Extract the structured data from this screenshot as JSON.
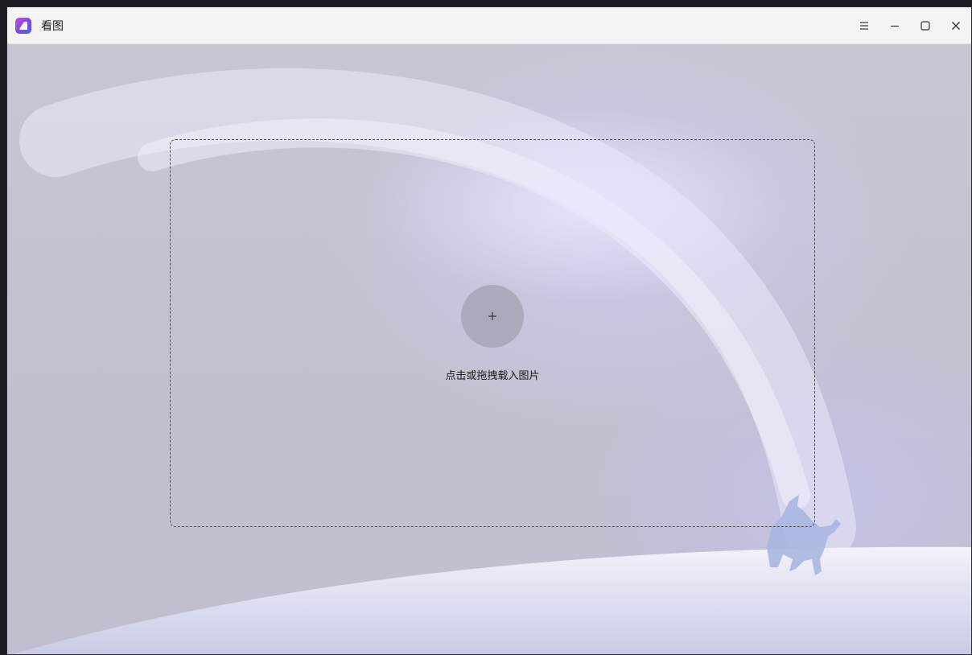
{
  "app": {
    "title": "看图",
    "icon": "image-viewer-app-icon"
  },
  "titlebar": {
    "controls": [
      {
        "name": "menu-icon",
        "glyph": "≡"
      },
      {
        "name": "minimize-icon",
        "glyph": "–"
      },
      {
        "name": "maximize-icon",
        "glyph": "□"
      },
      {
        "name": "close-icon",
        "glyph": "×"
      }
    ]
  },
  "dropzone": {
    "hint": "点击或拖拽载入图片",
    "add_icon": "plus-icon"
  },
  "colors": {
    "titlebar_bg": "#f4f4f5",
    "content_bg": "#c4c2d1",
    "accent_logo": "#7a4be0"
  }
}
